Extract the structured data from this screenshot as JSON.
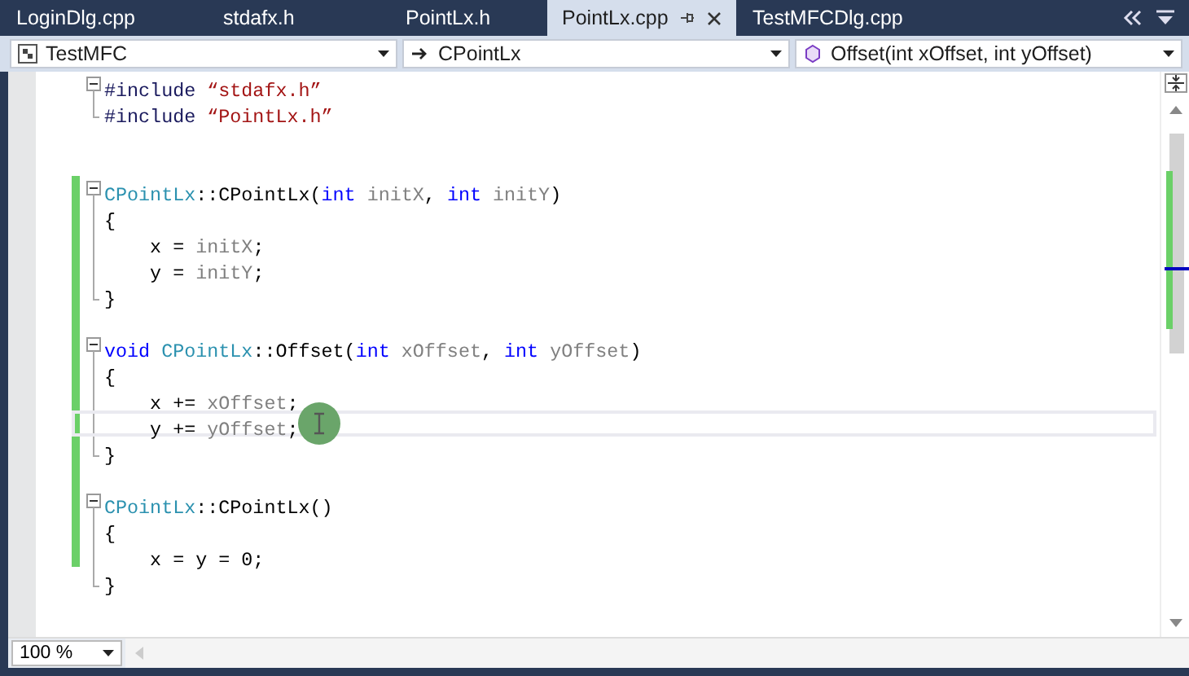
{
  "tabs": [
    {
      "label": "LoginDlg.cpp",
      "selected": false
    },
    {
      "label": "stdafx.h",
      "selected": false
    },
    {
      "label": "PointLx.h",
      "selected": false
    },
    {
      "label": "PointLx.cpp",
      "selected": true
    },
    {
      "label": "TestMFCDlg.cpp",
      "selected": false
    }
  ],
  "navigation": {
    "project": "TestMFC",
    "class": "CPointLx",
    "member": "Offset(int xOffset, int yOffset)"
  },
  "code_lines": [
    {
      "kind": "opening",
      "changed": false,
      "current": false,
      "tokens": [
        {
          "kind": "preproc",
          "text": "#include "
        },
        {
          "kind": "string",
          "text": "“stdafx.h”"
        }
      ]
    },
    {
      "kind": "closing",
      "changed": false,
      "current": false,
      "tokens": [
        {
          "kind": "preproc",
          "text": "#include "
        },
        {
          "kind": "string",
          "text": "“PointLx.h”"
        }
      ]
    },
    {
      "kind": "plain",
      "changed": false,
      "current": false
    },
    {
      "kind": "plain",
      "changed": false,
      "current": false
    },
    {
      "kind": "opening",
      "changed": true,
      "current": false,
      "tokens": [
        {
          "kind": "type",
          "text": "CPointLx"
        },
        {
          "kind": "plain",
          "text": "::CPointLx("
        },
        {
          "kind": "keyword",
          "text": "int "
        },
        {
          "kind": "param",
          "text": "initX"
        },
        {
          "kind": "plain",
          "text": ", "
        },
        {
          "kind": "keyword",
          "text": "int "
        },
        {
          "kind": "param",
          "text": "initY"
        },
        {
          "kind": "plain",
          "text": ")"
        }
      ]
    },
    {
      "kind": "body",
      "changed": true,
      "current": false,
      "tokens": [
        {
          "kind": "plain",
          "text": "{"
        }
      ]
    },
    {
      "kind": "body",
      "changed": true,
      "current": false,
      "tokens": [
        {
          "kind": "plain",
          "text": "    x = "
        },
        {
          "kind": "param",
          "text": "initX"
        },
        {
          "kind": "plain",
          "text": ";"
        }
      ]
    },
    {
      "kind": "body",
      "changed": true,
      "current": false,
      "tokens": [
        {
          "kind": "plain",
          "text": "    y = "
        },
        {
          "kind": "param",
          "text": "initY"
        },
        {
          "kind": "plain",
          "text": ";"
        }
      ]
    },
    {
      "kind": "closing",
      "changed": true,
      "current": false,
      "tokens": [
        {
          "kind": "plain",
          "text": "}"
        }
      ]
    },
    {
      "kind": "plain",
      "changed": true,
      "current": false
    },
    {
      "kind": "opening",
      "changed": true,
      "current": false,
      "tokens": [
        {
          "kind": "keyword",
          "text": "void "
        },
        {
          "kind": "type",
          "text": "CPointLx"
        },
        {
          "kind": "plain",
          "text": "::Offset("
        },
        {
          "kind": "keyword",
          "text": "int "
        },
        {
          "kind": "param",
          "text": "xOffset"
        },
        {
          "kind": "plain",
          "text": ", "
        },
        {
          "kind": "keyword",
          "text": "int "
        },
        {
          "kind": "param",
          "text": "yOffset"
        },
        {
          "kind": "plain",
          "text": ")"
        }
      ]
    },
    {
      "kind": "body",
      "changed": true,
      "current": false,
      "tokens": [
        {
          "kind": "plain",
          "text": "{"
        }
      ]
    },
    {
      "kind": "body",
      "changed": true,
      "current": false,
      "tokens": [
        {
          "kind": "plain",
          "text": "    x += "
        },
        {
          "kind": "param",
          "text": "xOffset"
        },
        {
          "kind": "plain",
          "text": ";"
        }
      ]
    },
    {
      "kind": "body",
      "changed": true,
      "current": true,
      "tokens": [
        {
          "kind": "plain",
          "text": "    y += "
        },
        {
          "kind": "param",
          "text": "yOffset"
        },
        {
          "kind": "plain",
          "text": ";"
        }
      ]
    },
    {
      "kind": "closing",
      "changed": true,
      "current": false,
      "tokens": [
        {
          "kind": "plain",
          "text": "}"
        }
      ]
    },
    {
      "kind": "plain",
      "changed": true,
      "current": false
    },
    {
      "kind": "opening",
      "changed": true,
      "current": false,
      "tokens": [
        {
          "kind": "type",
          "text": "CPointLx"
        },
        {
          "kind": "plain",
          "text": "::CPointLx()"
        }
      ]
    },
    {
      "kind": "body",
      "changed": true,
      "current": false,
      "tokens": [
        {
          "kind": "plain",
          "text": "{"
        }
      ]
    },
    {
      "kind": "body",
      "changed": true,
      "current": false,
      "tokens": [
        {
          "kind": "plain",
          "text": "    x = y = 0;"
        }
      ]
    },
    {
      "kind": "closing",
      "changed": false,
      "current": false,
      "tokens": [
        {
          "kind": "plain",
          "text": "}"
        }
      ]
    }
  ],
  "zoom": "100 %"
}
